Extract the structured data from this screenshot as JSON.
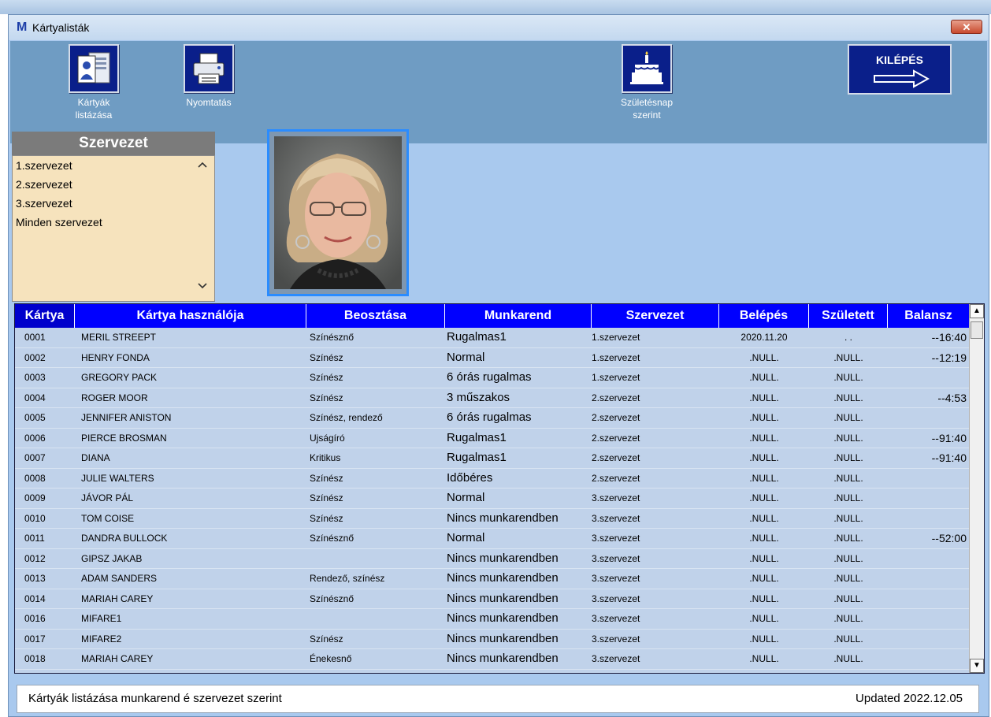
{
  "window": {
    "title": "Kártyalisták",
    "logo_letter": "M",
    "close_glyph": "✕"
  },
  "toolbar": {
    "list_cards_label_1": "Kártyák",
    "list_cards_label_2": "listázása",
    "print_label": "Nyomtatás",
    "birthday_label_1": "Születésnap",
    "birthday_label_2": "szerint",
    "exit_label": "KILÉPÉS"
  },
  "org_panel": {
    "header": "Szervezet",
    "items": [
      "1.szervezet",
      "2.szervezet",
      "3.szervezet",
      "Minden szervezet"
    ]
  },
  "grid": {
    "columns": [
      "Kártya",
      "Kártya használója",
      "Beosztása",
      "Munkarend",
      "Szervezet",
      "Belépés",
      "Született",
      "Balansz"
    ],
    "rows": [
      [
        "0001",
        "MERIL STREEPT",
        "Színésznő",
        "Rugalmas1",
        "1.szervezet",
        "2020.11.20",
        ". .",
        "--16:40"
      ],
      [
        "0002",
        "HENRY FONDA",
        "Színész",
        "Normal",
        "1.szervezet",
        ".NULL.",
        ".NULL.",
        "--12:19"
      ],
      [
        "0003",
        "GREGORY PACK",
        "Színész",
        "6 órás rugalmas",
        "1.szervezet",
        ".NULL.",
        ".NULL.",
        ""
      ],
      [
        "0004",
        "ROGER MOOR",
        "Színész",
        "3 műszakos",
        "2.szervezet",
        ".NULL.",
        ".NULL.",
        "--4:53"
      ],
      [
        "0005",
        "JENNIFER ANISTON",
        "Színész, rendező",
        "6 órás rugalmas",
        "2.szervezet",
        ".NULL.",
        ".NULL.",
        ""
      ],
      [
        "0006",
        "PIERCE BROSMAN",
        "Ujságíró",
        "Rugalmas1",
        "2.szervezet",
        ".NULL.",
        ".NULL.",
        "--91:40"
      ],
      [
        "0007",
        "DIANA",
        "Kritikus",
        "Rugalmas1",
        "2.szervezet",
        ".NULL.",
        ".NULL.",
        "--91:40"
      ],
      [
        "0008",
        "JULIE WALTERS",
        "Színész",
        "Időbéres",
        "2.szervezet",
        ".NULL.",
        ".NULL.",
        ""
      ],
      [
        "0009",
        "JÁVOR PÁL",
        "Színész",
        "Normal",
        "3.szervezet",
        ".NULL.",
        ".NULL.",
        ""
      ],
      [
        "0010",
        "TOM COISE",
        "Színész",
        "Nincs munkarendben",
        "3.szervezet",
        ".NULL.",
        ".NULL.",
        ""
      ],
      [
        "0011",
        "DANDRA BULLOCK",
        "Színésznő",
        "Normal",
        "3.szervezet",
        ".NULL.",
        ".NULL.",
        "--52:00"
      ],
      [
        "0012",
        "GIPSZ JAKAB",
        "",
        "Nincs munkarendben",
        "3.szervezet",
        ".NULL.",
        ".NULL.",
        ""
      ],
      [
        "0013",
        "ADAM SANDERS",
        "Rendező, színész",
        "Nincs munkarendben",
        "3.szervezet",
        ".NULL.",
        ".NULL.",
        ""
      ],
      [
        "0014",
        "MARIAH CAREY",
        "Színésznő",
        "Nincs munkarendben",
        "3.szervezet",
        ".NULL.",
        ".NULL.",
        ""
      ],
      [
        "0016",
        "MIFARE1",
        "",
        "Nincs munkarendben",
        "3.szervezet",
        ".NULL.",
        ".NULL.",
        ""
      ],
      [
        "0017",
        "MIFARE2",
        "Színész",
        "Nincs munkarendben",
        "3.szervezet",
        ".NULL.",
        ".NULL.",
        ""
      ],
      [
        "0018",
        "MARIAH CAREY",
        "Énekesnő",
        "Nincs munkarendben",
        "3.szervezet",
        ".NULL.",
        ".NULL.",
        ""
      ]
    ]
  },
  "status": {
    "left": "Kártyák listázása munkarend é szervezet szerint",
    "right": "Updated  2022.12.05"
  },
  "colors": {
    "toolbar_bg": "#6f9cc3",
    "window_bg": "#a9c9ee",
    "header_blue": "#0000ff",
    "button_navy": "#0a1f8a",
    "org_list_bg": "#f6e3bd"
  }
}
